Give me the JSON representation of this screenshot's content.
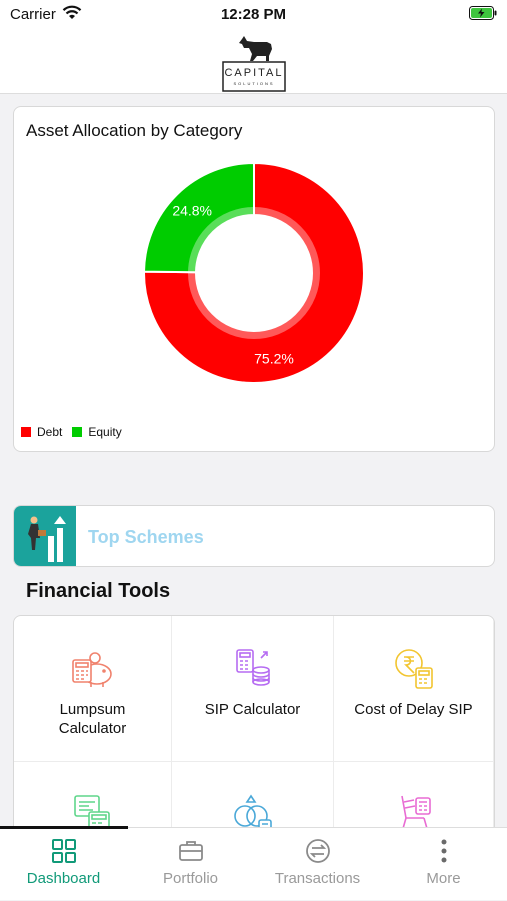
{
  "status": {
    "carrier": "Carrier",
    "time": "12:28 PM"
  },
  "header": {
    "logo_text": "CAPITAL",
    "logo_sub": "SOLUTIONS"
  },
  "allocation": {
    "title": "Asset Allocation by Category",
    "legend": [
      {
        "label": "Debt",
        "color": "#ff0000"
      },
      {
        "label": "Equity",
        "color": "#00cc00"
      }
    ]
  },
  "chart_data": {
    "type": "pie",
    "title": "Asset Allocation by Category",
    "categories": [
      "Debt",
      "Equity"
    ],
    "values": [
      75.2,
      24.8
    ],
    "labels": [
      "75.2%",
      "24.8%"
    ],
    "colors": [
      "#ff0000",
      "#00cc00"
    ],
    "legend": "bottom-left"
  },
  "top_schemes": {
    "label": "Top Schemes"
  },
  "financial_tools": {
    "title": "Financial Tools",
    "items": [
      {
        "label": "Lumpsum Calculator",
        "icon": "piggy-bank-icon",
        "color": "#f0826d"
      },
      {
        "label": "SIP Calculator",
        "icon": "coins-calculator-icon",
        "color": "#b66cf2"
      },
      {
        "label": "Cost of Delay SIP",
        "icon": "rupee-calculator-icon",
        "color": "#f2c530"
      },
      {
        "label": "",
        "icon": "calculator-notes-icon",
        "color": "#5fd68a"
      },
      {
        "label": "",
        "icon": "rings-calculator-icon",
        "color": "#4aa8d8"
      },
      {
        "label": "",
        "icon": "rocking-chair-icon",
        "color": "#e86bd3"
      }
    ]
  },
  "tabs": [
    {
      "label": "Dashboard",
      "icon": "grid-icon",
      "active": true
    },
    {
      "label": "Portfolio",
      "icon": "briefcase-icon",
      "active": false
    },
    {
      "label": "Transactions",
      "icon": "exchange-icon",
      "active": false
    },
    {
      "label": "More",
      "icon": "more-vertical-icon",
      "active": false
    }
  ]
}
